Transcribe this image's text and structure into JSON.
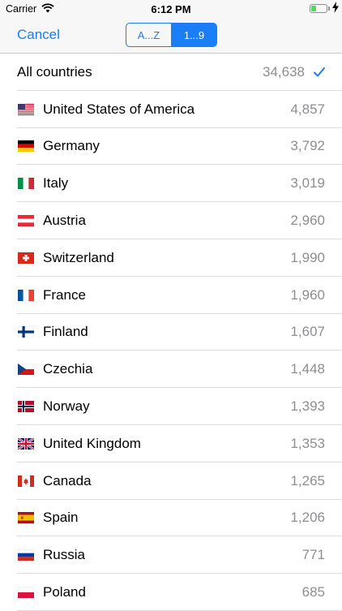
{
  "status_bar": {
    "carrier": "Carrier",
    "time": "6:12 PM",
    "battery_color": "#4cd964",
    "battery_level": 0.35
  },
  "nav": {
    "cancel_label": "Cancel",
    "segments": [
      {
        "label": "A...Z",
        "selected": false
      },
      {
        "label": "1...9",
        "selected": true
      }
    ],
    "accent_color": "#1a7ef6"
  },
  "all_countries": {
    "label": "All countries",
    "value": "34,638",
    "checked": true
  },
  "countries": [
    {
      "name": "United States of America",
      "value": "4,857",
      "flag": "us"
    },
    {
      "name": "Germany",
      "value": "3,792",
      "flag": "de"
    },
    {
      "name": "Italy",
      "value": "3,019",
      "flag": "it"
    },
    {
      "name": "Austria",
      "value": "2,960",
      "flag": "at"
    },
    {
      "name": "Switzerland",
      "value": "1,990",
      "flag": "ch"
    },
    {
      "name": "France",
      "value": "1,960",
      "flag": "fr"
    },
    {
      "name": "Finland",
      "value": "1,607",
      "flag": "fi"
    },
    {
      "name": "Czechia",
      "value": "1,448",
      "flag": "cz"
    },
    {
      "name": "Norway",
      "value": "1,393",
      "flag": "no"
    },
    {
      "name": "United Kingdom",
      "value": "1,353",
      "flag": "gb"
    },
    {
      "name": "Canada",
      "value": "1,265",
      "flag": "ca"
    },
    {
      "name": "Spain",
      "value": "1,206",
      "flag": "es"
    },
    {
      "name": "Russia",
      "value": "771",
      "flag": "ru"
    },
    {
      "name": "Poland",
      "value": "685",
      "flag": "pl"
    }
  ]
}
